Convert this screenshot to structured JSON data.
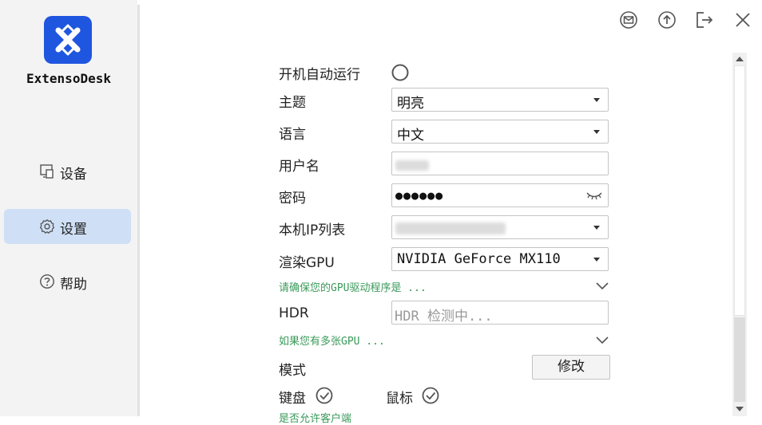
{
  "app": {
    "name": "ExtensoDesk"
  },
  "colors": {
    "accent": "#1f56e0",
    "sidebar_active": "#cfe0f6",
    "hint_green": "#3a9a5a"
  },
  "sidebar": {
    "items": [
      {
        "label": "设备",
        "icon": "device-icon",
        "active": false
      },
      {
        "label": "设置",
        "icon": "gear-icon",
        "active": true
      },
      {
        "label": "帮助",
        "icon": "help-icon",
        "active": false
      }
    ]
  },
  "topbar": {
    "icons": [
      "mail-icon",
      "upload-icon",
      "logout-icon",
      "close-icon"
    ]
  },
  "settings": {
    "autostart_label": "开机自动运行",
    "theme_label": "主题",
    "theme_value": "明亮",
    "language_label": "语言",
    "language_value": "中文",
    "username_label": "用户名",
    "password_label": "密码",
    "password_value": "●●●●●●",
    "ip_list_label": "本机IP列表",
    "gpu_label": "渲染GPU",
    "gpu_value": "NVIDIA GeForce MX110",
    "gpu_hint": "请确保您的GPU驱动程序是 ...",
    "hdr_label": "HDR",
    "hdr_placeholder": "HDR 检测中...",
    "multi_gpu_hint": "如果您有多张GPU ...",
    "mode_label": "模式",
    "modify_button": "修改",
    "keyboard_label": "键盘",
    "mouse_label": "鼠标",
    "cut_hint": "是否允许客户端"
  }
}
